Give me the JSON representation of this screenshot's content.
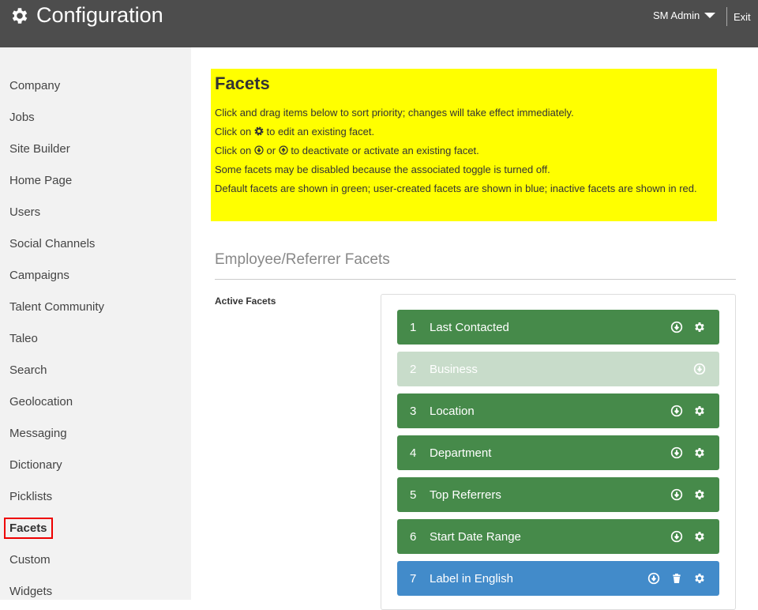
{
  "header": {
    "title": "Configuration",
    "user": "SM Admin",
    "exit": "Exit"
  },
  "sidebar": {
    "items": [
      "Company",
      "Jobs",
      "Site Builder",
      "Home Page",
      "Users",
      "Social Channels",
      "Campaigns",
      "Talent Community",
      "Taleo",
      "Search",
      "Geolocation",
      "Messaging",
      "Dictionary",
      "Picklists",
      "Facets",
      "Custom",
      "Widgets"
    ],
    "active": "Facets"
  },
  "info": {
    "title": "Facets",
    "line1": "Click and drag items below to sort priority; changes will take effect immediately.",
    "line2a": "Click on",
    "line2b": "to edit an existing facet.",
    "line3a": "Click on",
    "line3b": "or",
    "line3c": "to deactivate or activate an existing facet.",
    "line4": "Some facets may be disabled because the associated toggle is turned off.",
    "line5": "Default facets are shown in green; user-created facets are shown in blue; inactive facets are shown in red."
  },
  "section": {
    "title": "Employee/Referrer Facets",
    "active_label": "Active Facets"
  },
  "facets": [
    {
      "num": "1",
      "name": "Last Contacted",
      "type": "default"
    },
    {
      "num": "2",
      "name": "Business",
      "type": "disabled"
    },
    {
      "num": "3",
      "name": "Location",
      "type": "default"
    },
    {
      "num": "4",
      "name": "Department",
      "type": "default"
    },
    {
      "num": "5",
      "name": "Top Referrers",
      "type": "default"
    },
    {
      "num": "6",
      "name": "Start Date Range",
      "type": "default"
    },
    {
      "num": "7",
      "name": "Label in English",
      "type": "user"
    }
  ],
  "colors": {
    "default": "#468a4a",
    "disabled": "#c8dcca",
    "user": "#428bca",
    "highlight": "#ffff00"
  }
}
